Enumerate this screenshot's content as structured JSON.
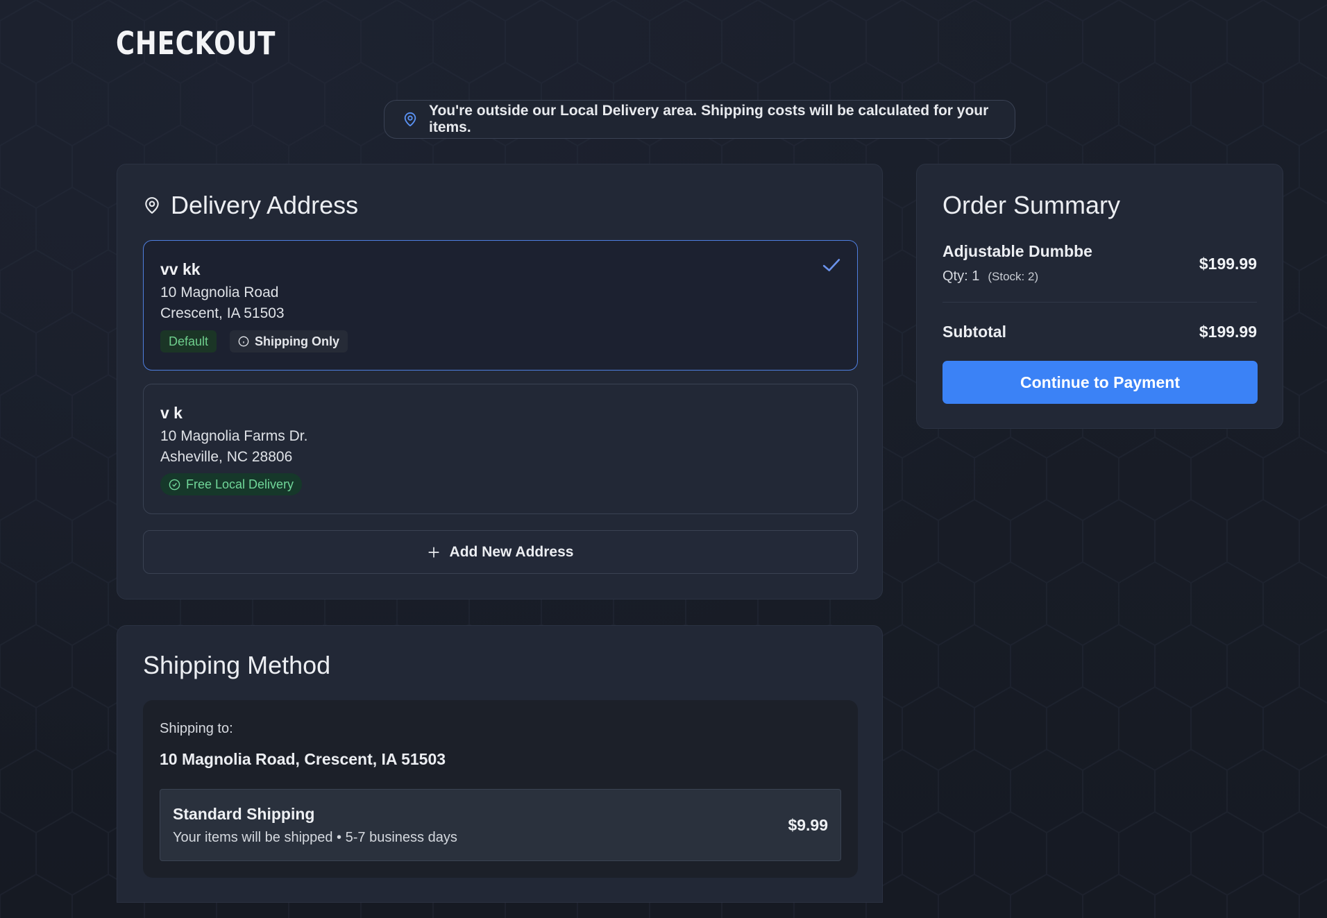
{
  "page": {
    "title": "CHECKOUT"
  },
  "notice": {
    "icon": "map-pin-icon",
    "text": "You're outside our Local Delivery area. Shipping costs will be calculated for your items."
  },
  "delivery": {
    "title": "Delivery Address",
    "icon": "map-pin-icon",
    "addresses": [
      {
        "name": "vv kk",
        "line1": "10 Magnolia Road",
        "line2": "Crescent, IA 51503",
        "selected": true,
        "badges": [
          "Default",
          "Shipping Only"
        ]
      },
      {
        "name": "v k",
        "line1": "10 Magnolia Farms Dr.",
        "line2": "Asheville, NC 28806",
        "selected": false,
        "badges": [
          "Free Local Delivery"
        ]
      }
    ],
    "add_label": "Add New Address"
  },
  "shipping": {
    "title": "Shipping Method",
    "ship_to_label": "Shipping to:",
    "ship_to_address": "10 Magnolia Road, Crescent, IA 51503",
    "option": {
      "name": "Standard Shipping",
      "description": "Your items will be shipped • 5-7 business days",
      "price": "$9.99"
    }
  },
  "summary": {
    "title": "Order Summary",
    "item_name": "Adjustable Dumbbe",
    "qty": "Qty: 1",
    "stock": "(Stock: 2)",
    "item_price": "$199.99",
    "subtotal_label": "Subtotal",
    "subtotal_value": "$199.99",
    "cta": "Continue to Payment"
  },
  "colors": {
    "accent": "#3b82f6",
    "background": "#181d27",
    "card": "#222836",
    "success": "#71d79a"
  }
}
